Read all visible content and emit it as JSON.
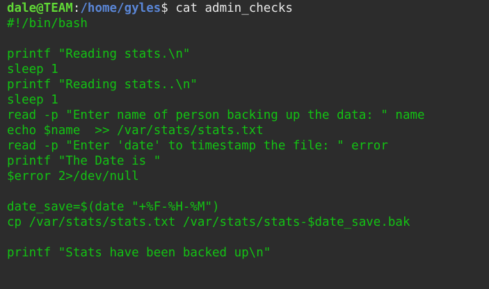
{
  "terminal": {
    "prompt": {
      "user_host": "dale@TEAM",
      "separator": ":",
      "path": "/home/gyles",
      "symbol": "$",
      "command": "cat admin_checks"
    },
    "lines": [
      "#!/bin/bash",
      "",
      "printf \"Reading stats.\\n\"",
      "sleep 1",
      "printf \"Reading stats..\\n\"",
      "sleep 1",
      "read -p \"Enter name of person backing up the data: \" name",
      "echo $name  >> /var/stats/stats.txt",
      "read -p \"Enter 'date' to timestamp the file: \" error",
      "printf \"The Date is \"",
      "$error 2>/dev/null",
      "",
      "date_save=$(date \"+%F-%H-%M\")",
      "cp /var/stats/stats.txt /var/stats/stats-$date_save.bak",
      "",
      "printf \"Stats have been backed up\\n\""
    ],
    "colors": {
      "background": "#2c2c2c",
      "output_text": "#13c313",
      "user_host": "#60d836",
      "path": "#5a86d6",
      "command": "#e8e8e8"
    }
  }
}
